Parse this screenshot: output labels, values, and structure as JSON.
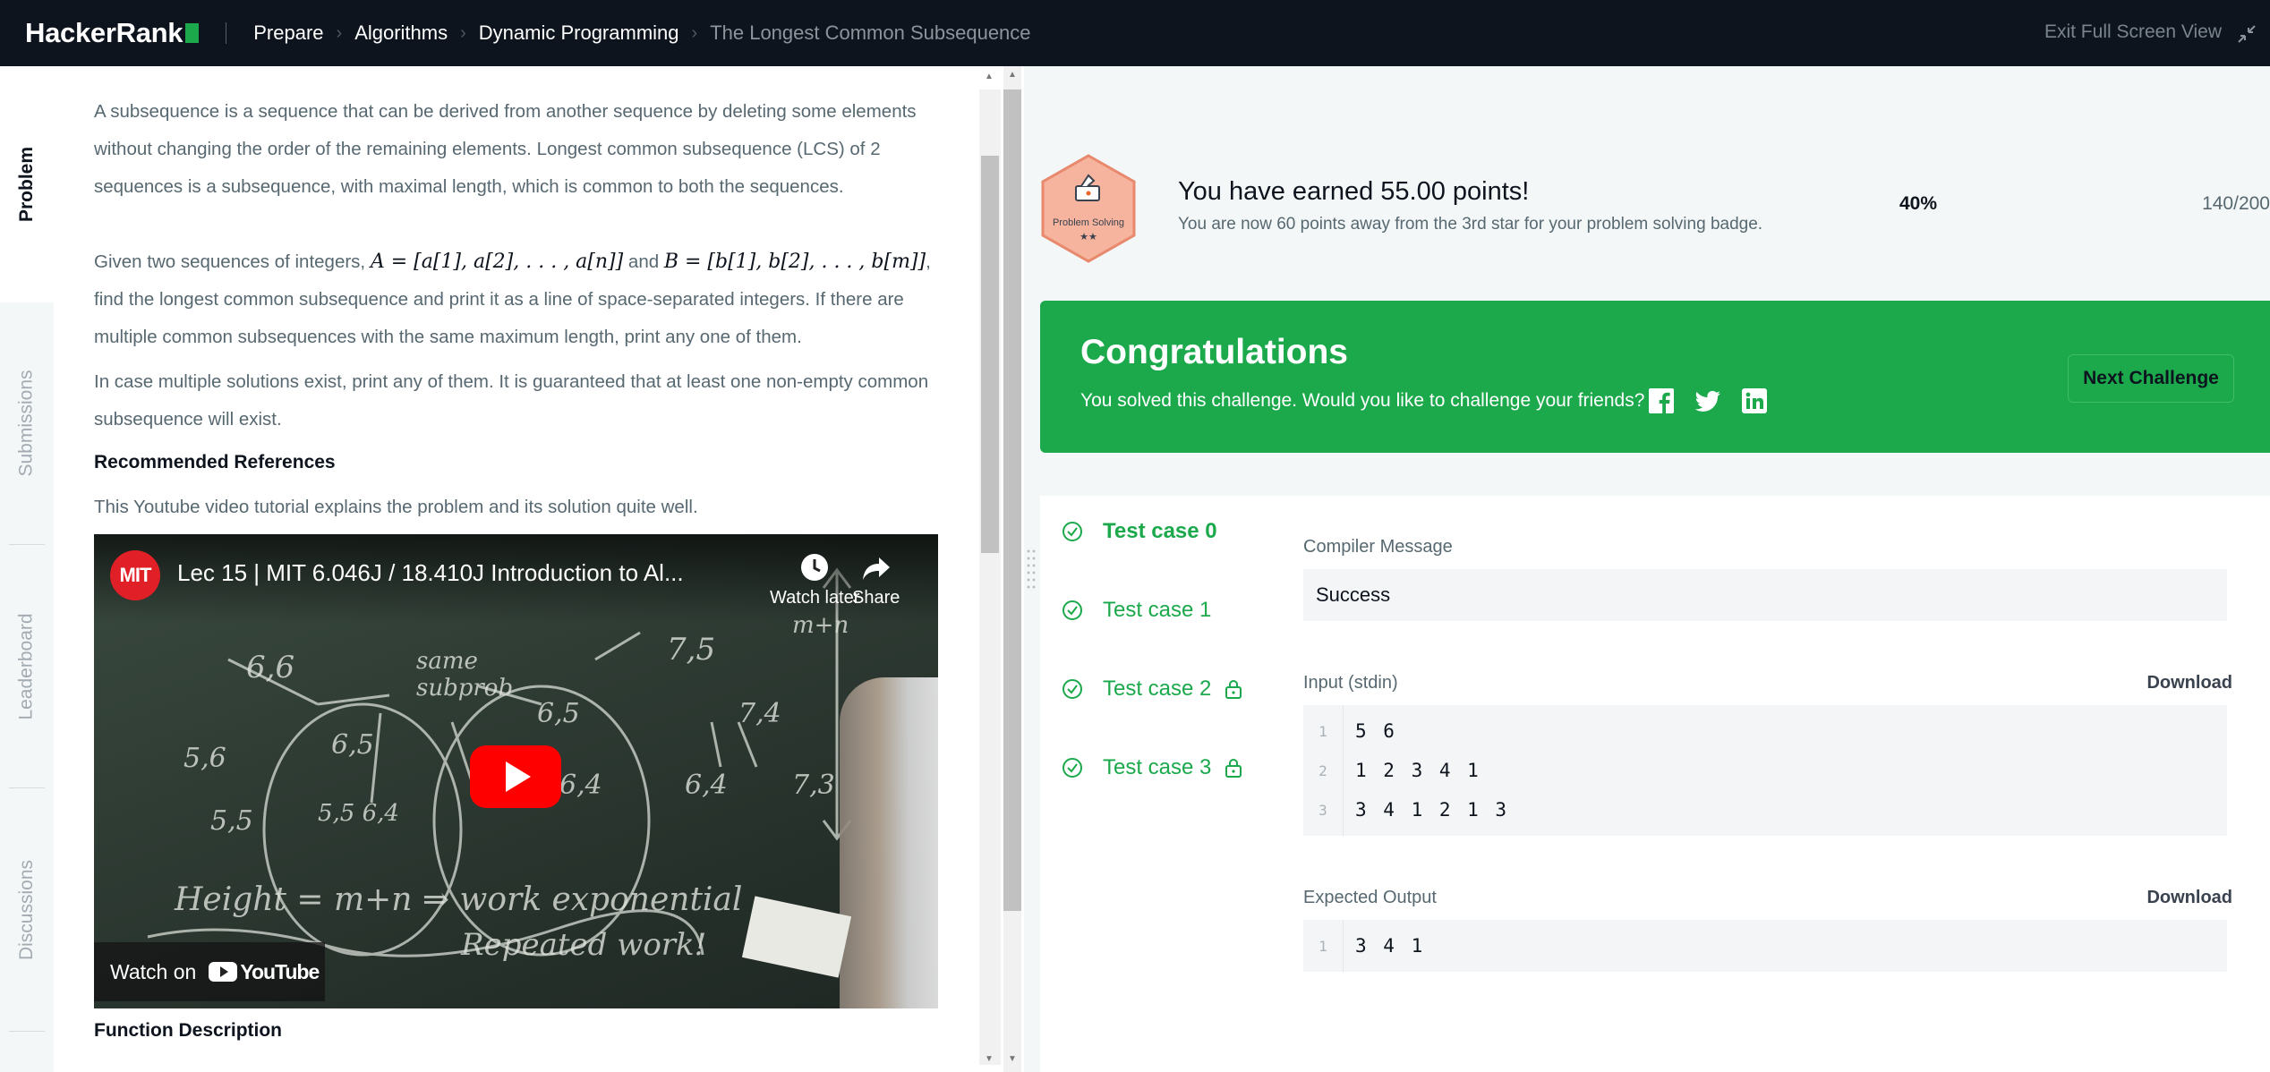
{
  "topbar": {
    "logo": "HackerRank",
    "breadcrumbs": [
      "Prepare",
      "Algorithms",
      "Dynamic Programming",
      "The Longest Common Subsequence"
    ],
    "exit_fullscreen": "Exit Full Screen View"
  },
  "sidebar": {
    "tabs": [
      "Problem",
      "Submissions",
      "Leaderboard",
      "Discussions"
    ],
    "active": "Problem"
  },
  "problem": {
    "para1": "A subsequence is a sequence that can be derived from another sequence by deleting some elements without changing the order of the remaining elements. Longest common subsequence (LCS) of 2 sequences is a subsequence, with maximal length, which is common to both the sequences.",
    "para2_pre": "Given two sequences of integers, ",
    "math_a": "A = [a[1], a[2], . . . , a[n]]",
    "para2_mid": " and ",
    "math_b": "B = [b[1], b[2], . . . , b[m]]",
    "para2_post": ", find the longest common subsequence and print it as a line of space-separated integers. If there are multiple common subsequences with the same maximum length, print any one of them.",
    "para3": "In case multiple solutions exist, print any of them. It is guaranteed that at least one non-empty common subsequence will exist.",
    "references_heading": "Recommended References",
    "references_text": "This Youtube video tutorial explains the problem and its solution quite well.",
    "function_heading": "Function Description"
  },
  "video": {
    "channel_badge": "MIT",
    "title": "Lec 15 | MIT 6.046J / 18.410J Introduction to Al...",
    "watch_later": "Watch later",
    "share": "Share",
    "watch_on": "Watch on",
    "youtube": "YouTube"
  },
  "results": {
    "badge_label": "Problem Solving",
    "badge_stars": "★★",
    "earned": "You have earned 55.00 points!",
    "away": "You are now 60 points away from the 3rd star for your problem solving badge.",
    "progress_percent": "40%",
    "progress_points": "140/200",
    "congrats_title": "Congratulations",
    "congrats_sub": "You solved this challenge. Would you like to challenge your friends?",
    "next_challenge": "Next Challenge",
    "test_cases": [
      {
        "label": "Test case 0",
        "locked": false
      },
      {
        "label": "Test case 1",
        "locked": false
      },
      {
        "label": "Test case 2",
        "locked": true
      },
      {
        "label": "Test case 3",
        "locked": true
      }
    ],
    "compiler_label": "Compiler Message",
    "compiler_message": "Success",
    "input_label": "Input (stdin)",
    "download": "Download",
    "input_lines": [
      {
        "n": "1",
        "text": "5 6"
      },
      {
        "n": "2",
        "text": "1 2 3 4 1"
      },
      {
        "n": "3",
        "text": "3 4 1 2 1 3"
      }
    ],
    "expected_label": "Expected Output",
    "expected_lines": [
      {
        "n": "1",
        "text": "3 4 1"
      }
    ]
  },
  "colors": {
    "topbar": "#0e141e",
    "accent_green": "#1ba94c",
    "badge_orange": "#f9a28a"
  }
}
